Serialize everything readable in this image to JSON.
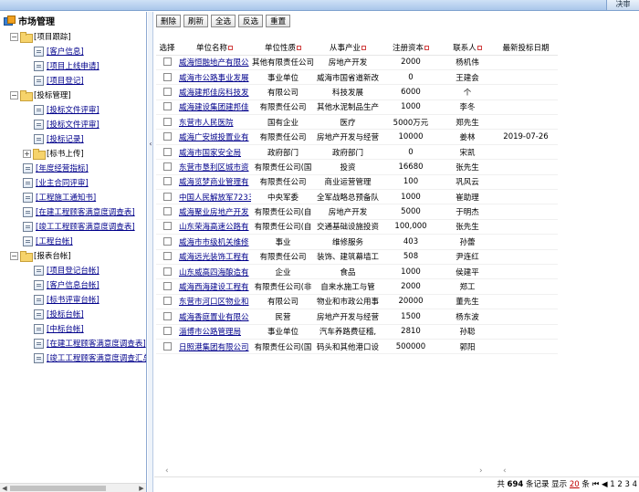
{
  "topbar": {
    "right_button": "决审"
  },
  "sidebar": {
    "title": "市场管理",
    "groups": [
      {
        "label": "[项目跟踪]",
        "items": [
          "[客户信息]",
          "[项目上线申请]",
          "[项目登记]"
        ]
      },
      {
        "label": "[投标管理]",
        "items": [
          "[投标文件评审]",
          "[投标文件评审]",
          "[投标记录]"
        ],
        "sub": "[标书上传]"
      },
      {
        "label": "[年度经营指标]"
      },
      {
        "label": "[业主合同评审]"
      },
      {
        "label": "[工程施工通知书]"
      },
      {
        "label": "[在建工程顾客满意度调查表]"
      },
      {
        "label": "[竣工工程顾客满意度调查表]"
      },
      {
        "label": "[工程台帐]"
      },
      {
        "label": "[报表台帐]",
        "items": [
          "[项目登记台帐]",
          "[客户信息台帐]",
          "[标书评审台帐]",
          "[投标台帐]",
          "[中标台帐]",
          "[在建工程顾客满意度调查表]",
          "[竣工工程顾客满意度调查汇总"
        ]
      }
    ]
  },
  "toolbar": {
    "delete": "删除",
    "refresh": "刷新",
    "select_all": "全选",
    "invert": "反选",
    "reset": "重置"
  },
  "table": {
    "headers": [
      "选择",
      "单位名称",
      "单位性质",
      "从事产业",
      "注册资本",
      "联系人",
      "最新投标日期"
    ],
    "rows": [
      [
        "威海恒融地产有限公",
        "其他有限责任公司",
        "房地产开发",
        "2000",
        "杨机伟",
        ""
      ],
      [
        "威海市公路事业发展",
        "事业单位",
        "威海市国省道新改",
        "0",
        "王建会",
        ""
      ],
      [
        "威海建邦佳房科技发",
        "有限公司",
        "科技发展",
        "6000",
        "个",
        ""
      ],
      [
        "威海建设集团建邦佳",
        "有限责任公司",
        "其他水泥制品生产",
        "1000",
        "李冬",
        ""
      ],
      [
        "东营市人民医院",
        "国有企业",
        "医疗",
        "5000万元",
        "郑先生",
        ""
      ],
      [
        "威海广安城投置业有",
        "有限责任公司",
        "房地产开发与经营",
        "10000",
        "姜林",
        "2019-07-26"
      ],
      [
        "威海市国家安全局",
        "政府部门",
        "政府部门",
        "0",
        "宋凯",
        ""
      ],
      [
        "东营市垦利区城市资",
        "有限责任公司(国",
        "投资",
        "16680",
        "张先生",
        ""
      ],
      [
        "威海览梦商业管理有",
        "有限责任公司",
        "商业运营管理",
        "100",
        "巩风云",
        ""
      ],
      [
        "中国人民解放军7233",
        "中央军委",
        "全军战略总预备队",
        "1000",
        "崔助理",
        ""
      ],
      [
        "威海聚业房地产开发",
        "有限责任公司(自",
        "房地产开发",
        "5000",
        "于明杰",
        ""
      ],
      [
        "山东荣海高速公路有",
        "有限责任公司(自",
        "交通基础设施投资",
        "100,000",
        "张先生",
        ""
      ],
      [
        "威海市市级机关维修",
        "事业",
        "维修服务",
        "403",
        "孙蕾",
        ""
      ],
      [
        "威海远光装饰工程有",
        "有限责任公司",
        "装饰、建筑幕墙工",
        "508",
        "尹连红",
        ""
      ],
      [
        "山东威高四海酿造有",
        "企业",
        "食品",
        "1000",
        "侯建平",
        ""
      ],
      [
        "威海西海建设工程有",
        "有限责任公司(非",
        "自来水施工与管",
        "2000",
        "郑工",
        ""
      ],
      [
        "东营市河口区物业和",
        "有限公司",
        "物业和市政公用事",
        "20000",
        "董先生",
        ""
      ],
      [
        "威海香庭置业有限公",
        "民营",
        "房地产开发与经营",
        "1500",
        "杨东波",
        ""
      ],
      [
        "淄博市公路管理局",
        "事业单位",
        "汽车养路费征稽,",
        "2810",
        "孙聪",
        ""
      ],
      [
        "日照港集团有限公司",
        "有限责任公司(国",
        "码头和其他港口设",
        "500000",
        "郭阳",
        ""
      ]
    ]
  },
  "status": {
    "prefix": "共",
    "total": "694",
    "mid": "条记录 显示",
    "page_size": "20",
    "suffix": "条",
    "pages": "1 2 3 4"
  },
  "colors": {
    "link": "#00008b",
    "marker": "#d04040",
    "accent": "#0a3cc8"
  }
}
